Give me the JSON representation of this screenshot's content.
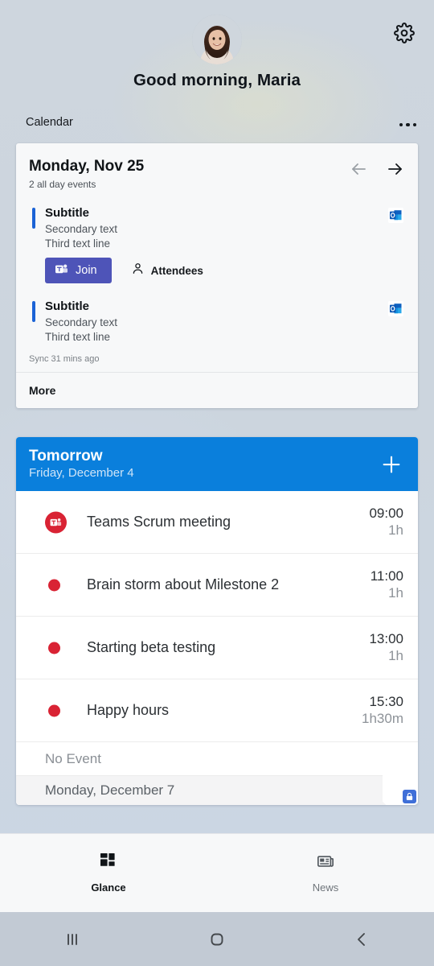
{
  "header": {
    "greeting": "Good morning, Maria",
    "avatar_alt": "avatar",
    "settings_icon": "gear-icon"
  },
  "section": {
    "title": "Calendar",
    "overflow_icon": "more-horizontal-icon"
  },
  "calendar_card": {
    "date": "Monday, Nov 25",
    "subtitle": "2 all day events",
    "prev_icon": "arrow-left-icon",
    "next_icon": "arrow-right-icon",
    "events": [
      {
        "title": "Subtitle",
        "secondary": "Secondary text",
        "third": "Third text line",
        "app_icon": "outlook-icon",
        "accent": "#1b63d6",
        "has_actions": true,
        "join_label": "Join",
        "join_icon": "teams-icon",
        "attendees_label": "Attendees",
        "attendees_icon": "person-icon"
      },
      {
        "title": "Subtitle",
        "secondary": "Secondary text",
        "third": "Third text line",
        "app_icon": "outlook-icon",
        "accent": "#1b63d6",
        "has_actions": false
      }
    ],
    "sync_status": "Sync 31 mins ago",
    "more_label": "More"
  },
  "tomorrow_card": {
    "title": "Tomorrow",
    "date": "Friday, December 4",
    "add_icon": "plus-icon",
    "header_color": "#0a7fdc",
    "events": [
      {
        "name": "Teams Scrum meeting",
        "start": "09:00",
        "duration": "1h",
        "icon": "teams-icon",
        "dot_color": "#d92334"
      },
      {
        "name": "Brain storm about Milestone 2",
        "start": "11:00",
        "duration": "1h",
        "icon": "dot-icon",
        "dot_color": "#d92334"
      },
      {
        "name": "Starting beta testing",
        "start": "13:00",
        "duration": "1h",
        "icon": "dot-icon",
        "dot_color": "#d92334"
      },
      {
        "name": "Happy hours",
        "start": "15:30",
        "duration": "1h30m",
        "icon": "dot-icon",
        "dot_color": "#d92334"
      }
    ],
    "no_event_label": "No Event",
    "next_day_label": "Monday, December 7",
    "lock_icon": "lock-icon"
  },
  "tabbar": {
    "tabs": [
      {
        "label": "Glance",
        "icon": "dashboard-icon",
        "active": true
      },
      {
        "label": "News",
        "icon": "news-icon",
        "active": false
      }
    ]
  },
  "sysnav": {
    "recents_icon": "recents-icon",
    "home_icon": "home-icon",
    "back_icon": "back-icon"
  }
}
